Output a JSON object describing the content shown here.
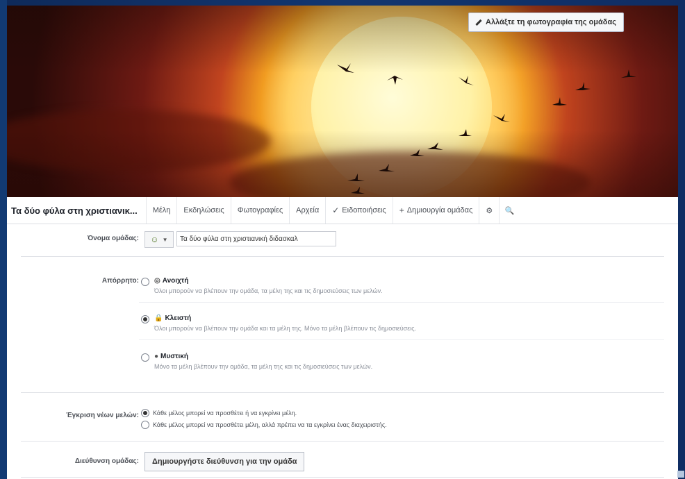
{
  "cover": {
    "change_photo_label": "Αλλάξτε τη φωτογραφία της ομάδας",
    "change_photo_icon": "pencil-icon"
  },
  "tabbar": {
    "group_name": "Τα δύο φύλα στη χριστιανικ...",
    "tabs": [
      {
        "label": "Μέλη",
        "icon": ""
      },
      {
        "label": "Εκδηλώσεις",
        "icon": ""
      },
      {
        "label": "Φωτογραφίες",
        "icon": ""
      },
      {
        "label": "Αρχεία",
        "icon": ""
      },
      {
        "label": "Ειδοποιήσεις",
        "icon": "✓"
      },
      {
        "label": "Δημιουργία ομάδας",
        "icon": "+"
      }
    ],
    "settings_icon": "gear-icon",
    "search_icon": "search-icon"
  },
  "settings": {
    "name": {
      "label": "Όνομα ομάδας:",
      "value": "Τα δύο φύλα στη χριστιανική διδασκαλ"
    },
    "privacy": {
      "label": "Απόρρητο:",
      "options": [
        {
          "title": "Ανοιχτή",
          "icon": "globe-icon",
          "desc": "Όλοι μπορούν να βλέπουν την ομάδα, τα μέλη της και τις δημοσιεύσεις των μελών.",
          "selected": false
        },
        {
          "title": "Κλειστή",
          "icon": "lock-icon",
          "desc": "Όλοι μπορούν να βλέπουν την ομάδα και τα μέλη της. Μόνο τα μέλη βλέπουν τις δημοσιεύσεις.",
          "selected": true
        },
        {
          "title": "Μυστική",
          "icon": "secret-icon",
          "desc": "Μόνο τα μέλη βλέπουν την ομάδα, τα μέλη της και τις δημοσιεύσεις των μελών.",
          "selected": false
        }
      ]
    },
    "membership_approval": {
      "label": "Έγκριση νέων μελών:",
      "options": [
        {
          "text": "Κάθε μέλος μπορεί να προσθέτει ή να εγκρίνει μέλη.",
          "selected": true
        },
        {
          "text": "Κάθε μέλος μπορεί να προσθέτει μέλη, αλλά πρέπει να τα εγκρίνει ένας διαχειριστής.",
          "selected": false
        }
      ]
    },
    "group_address": {
      "label": "Διεύθυνση ομάδας:",
      "button": "Δημιουργήστε διεύθυνση για την ομάδα"
    }
  },
  "colors": {
    "page_bg": "#123670",
    "tab_text": "#4b4f56",
    "muted_text": "#8a8f99"
  }
}
